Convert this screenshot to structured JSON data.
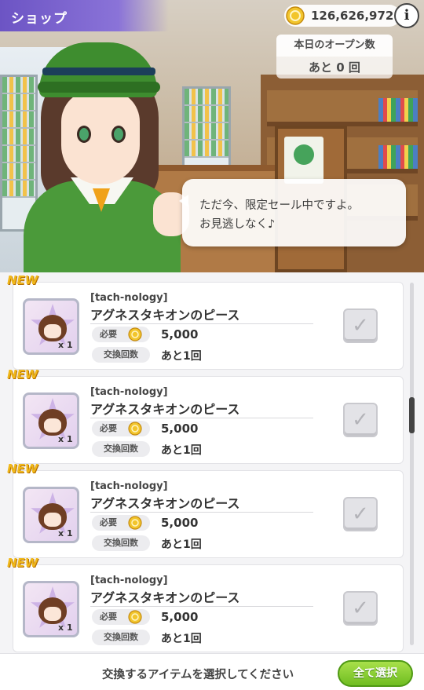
{
  "header": {
    "title": "ショップ",
    "coin_balance": "126,626,972",
    "info_icon": "i"
  },
  "open_count": {
    "label": "本日のオープン数",
    "value": "あと 0 回"
  },
  "speech": {
    "line1": "ただ今、限定セール中ですよ。",
    "line2": "お見逃しなく♪"
  },
  "labels": {
    "new": "NEW",
    "required": "必要",
    "exchange_count": "交換回数",
    "quantity_prefix": "x"
  },
  "items": [
    {
      "category": "[tach-nology]",
      "name": "アグネスタキオンのピース",
      "quantity": "1",
      "cost": "5,000",
      "remaining": "あと1回",
      "checked": false
    },
    {
      "category": "[tach-nology]",
      "name": "アグネスタキオンのピース",
      "quantity": "1",
      "cost": "5,000",
      "remaining": "あと1回",
      "checked": false
    },
    {
      "category": "[tach-nology]",
      "name": "アグネスタキオンのピース",
      "quantity": "1",
      "cost": "5,000",
      "remaining": "あと1回",
      "checked": false
    },
    {
      "category": "[tach-nology]",
      "name": "アグネスタキオンのピース",
      "quantity": "1",
      "cost": "5,000",
      "remaining": "あと1回",
      "checked": false
    }
  ],
  "footer": {
    "instruction": "交換するアイテムを選択してください",
    "select_all": "全て選択"
  },
  "colors": {
    "header_purple": "#6c54c4",
    "new_gold": "#f0b81b",
    "button_green": "#6fbd21"
  }
}
